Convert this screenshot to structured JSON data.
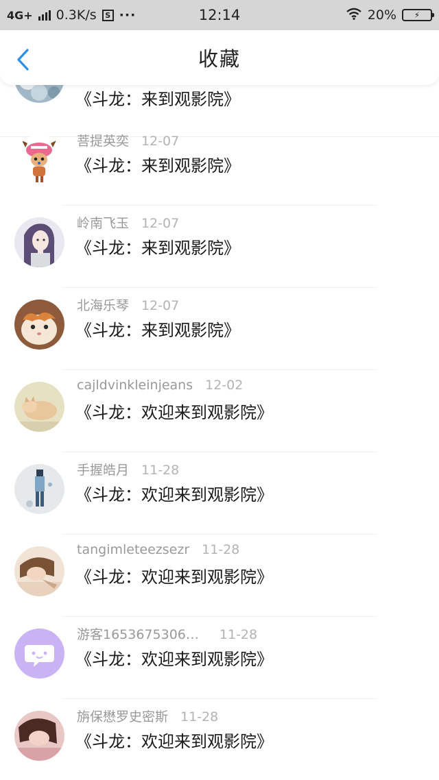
{
  "status_bar": {
    "network": "4G+",
    "speed": "0.3K/s",
    "box_icon_text": "S",
    "more_dots": "···",
    "time": "12:14",
    "battery_percent": "20%",
    "icons": [
      "signal-icon",
      "sim-box-icon",
      "more-dots-icon",
      "wifi-icon",
      "battery-charging-icon"
    ]
  },
  "nav": {
    "title": "收藏",
    "back_icon": "chevron-left-icon",
    "accent_color": "#2a8ff0"
  },
  "rows": [
    {
      "name": "",
      "date": "",
      "title": "《斗龙：来到观影院》",
      "avatar": "floral-avatar"
    },
    {
      "name": "菩提英奕",
      "date": "12-07",
      "title": "《斗龙：来到观影院》",
      "avatar": "cartoon-reindeer-avatar"
    },
    {
      "name": "岭南飞玉",
      "date": "12-07",
      "title": "《斗龙：来到观影院》",
      "avatar": "anime-girl-avatar"
    },
    {
      "name": "北海乐琴",
      "date": "12-07",
      "title": "《斗龙：来到观影院》",
      "avatar": "cat-avatar"
    },
    {
      "name": "cajldvinkleinjeans",
      "date": "12-02",
      "title": "《斗龙：欢迎来到观影院》",
      "avatar": "sleeping-cat-avatar"
    },
    {
      "name": "手握皓月",
      "date": "11-28",
      "title": "《斗龙：欢迎来到观影院》",
      "avatar": "figure-sketch-avatar"
    },
    {
      "name": "tangimleteezsezr",
      "date": "11-28",
      "title": "《斗龙：欢迎来到观影院》",
      "avatar": "portrait-avatar"
    },
    {
      "name": "游客1653675306…",
      "date": "11-28",
      "title": "《斗龙：欢迎来到观影院》",
      "avatar": "default-chat-avatar"
    },
    {
      "name": "旃保懋罗史密斯",
      "date": "11-28",
      "title": "《斗龙：欢迎来到观影院》",
      "avatar": "girl-photo-avatar"
    }
  ]
}
